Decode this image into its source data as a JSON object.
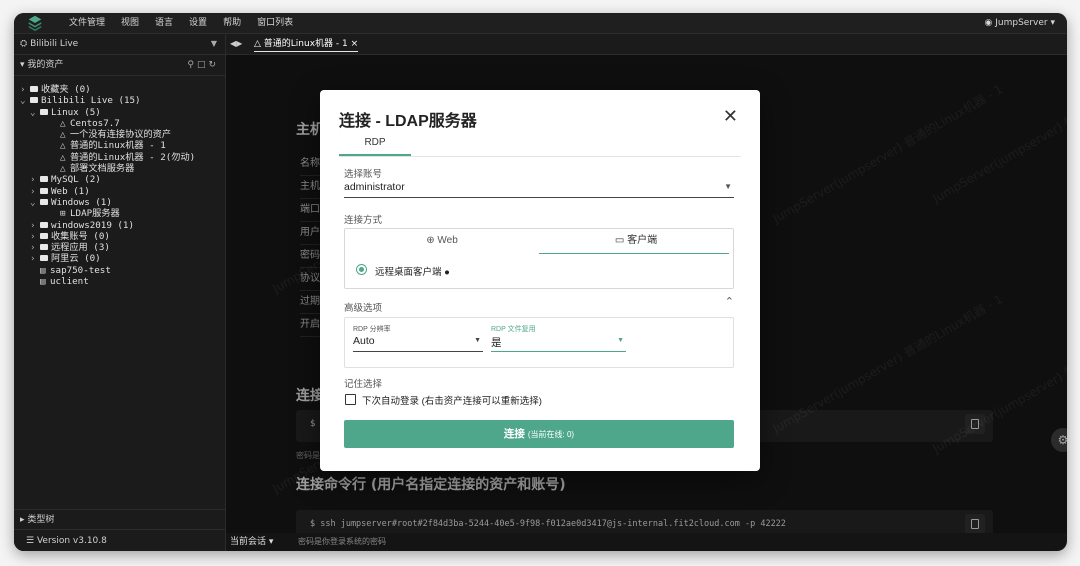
{
  "menubar": {
    "items": [
      "文件管理",
      "视图",
      "语言",
      "设置",
      "帮助",
      "窗口列表"
    ],
    "user": "JumpServer"
  },
  "sidebar": {
    "org": "Bilibili Live",
    "assets_title": "我的资产",
    "tree": [
      {
        "indent": 0,
        "arrow": "›",
        "type": "folder",
        "label": "收藏夹 (0)"
      },
      {
        "indent": 0,
        "arrow": "⌄",
        "type": "folder",
        "label": "Bilibili Live (15)"
      },
      {
        "indent": 1,
        "arrow": "⌄",
        "type": "folder",
        "label": "Linux (5)"
      },
      {
        "indent": 3,
        "arrow": "",
        "type": "leaf",
        "label": "Centos7.7"
      },
      {
        "indent": 3,
        "arrow": "",
        "type": "leaf",
        "label": "一个没有连接协议的资产"
      },
      {
        "indent": 3,
        "arrow": "",
        "type": "leaf",
        "label": "普通的Linux机器 - 1"
      },
      {
        "indent": 3,
        "arrow": "",
        "type": "leaf",
        "label": "普通的Linux机器 - 2(勿动)"
      },
      {
        "indent": 3,
        "arrow": "",
        "type": "leaf",
        "label": "部署文档服务器"
      },
      {
        "indent": 1,
        "arrow": "›",
        "type": "folder",
        "label": "MySQL (2)"
      },
      {
        "indent": 1,
        "arrow": "›",
        "type": "folder",
        "label": "Web (1)"
      },
      {
        "indent": 1,
        "arrow": "⌄",
        "type": "folder",
        "label": "Windows (1)"
      },
      {
        "indent": 3,
        "arrow": "",
        "type": "win",
        "label": "LDAP服务器"
      },
      {
        "indent": 1,
        "arrow": "›",
        "type": "folder",
        "label": "windows2019 (1)"
      },
      {
        "indent": 1,
        "arrow": "›",
        "type": "folder",
        "label": "收集账号 (0)"
      },
      {
        "indent": 1,
        "arrow": "›",
        "type": "folder",
        "label": "远程应用 (3)"
      },
      {
        "indent": 1,
        "arrow": "›",
        "type": "folder",
        "label": "阿里云 (0)"
      },
      {
        "indent": 1,
        "arrow": "",
        "type": "app",
        "label": "sap750-test"
      },
      {
        "indent": 1,
        "arrow": "",
        "type": "app",
        "label": "uclient"
      }
    ],
    "type_tree": "类型树",
    "version": "Version v3.10.8"
  },
  "tabbar": {
    "tab_label": "普通的Linux机器 - 1 ×"
  },
  "background": {
    "title": "主机",
    "rows": [
      "名称",
      "主机",
      "端口",
      "用户",
      "密码",
      "协议",
      "过期",
      "开启"
    ],
    "connect_title": "连接",
    "cmd1_prefix": "$",
    "pwd_hint": "密码是",
    "cmd_title": "连接命令行 (用户名指定连接的资产和账号)",
    "cmd2": "$ ssh jumpserver#root#2f84d3ba-5244-40e5-9f98-f012ae0d3417@js-internal.fit2cloud.com -p 42222",
    "pwd_hint2": "密码是你登录系统的密码",
    "watermark": "JumpServer(jumpserver) 普通的Linux机器 - 1"
  },
  "session_label": "当前会话 ▾",
  "modal": {
    "title": "连接 - LDAP服务器",
    "protocol_tab": "RDP",
    "account_label": "选择账号",
    "account_value": "administrator",
    "method_label": "连接方式",
    "method_web": "Web",
    "method_client": "客户端",
    "radio_label": "远程桌面客户端",
    "advanced_label": "高级选项",
    "resolution_label": "RDP 分辨率",
    "resolution_value": "Auto",
    "reuse_label": "RDP 文件复用",
    "reuse_value": "是",
    "remember_label": "记住选择",
    "auto_login_label": "下次自动登录 (右击资产连接可以重新选择)",
    "connect_button": "连接",
    "connect_sub": "(当前在线: 0)"
  },
  "colors": {
    "accent": "#4fa78b",
    "dark_bg": "#141414"
  }
}
